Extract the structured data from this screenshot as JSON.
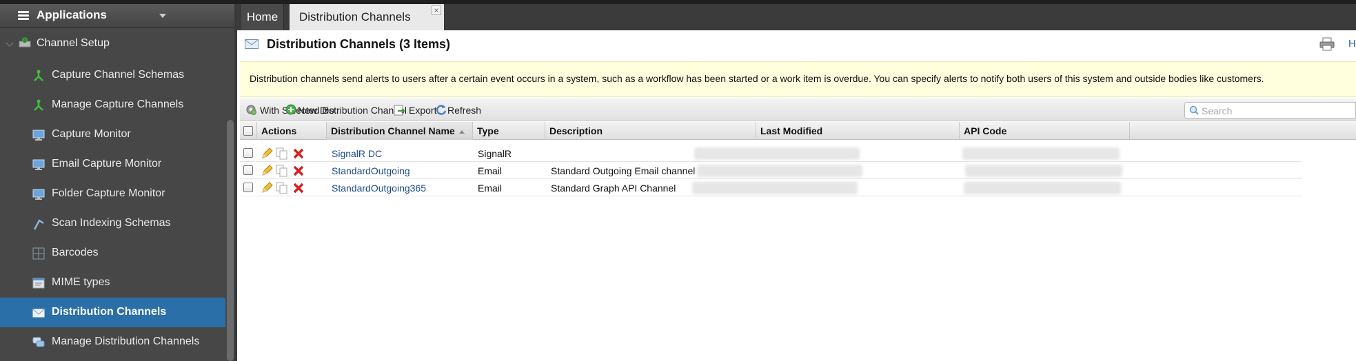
{
  "sidebar": {
    "header_title": "Applications",
    "root_label": "Channel Setup",
    "items": [
      {
        "label": "Capture Channel Schemas",
        "icon": "schema-icon"
      },
      {
        "label": "Manage Capture Channels",
        "icon": "schema-icon"
      },
      {
        "label": "Capture Monitor",
        "icon": "monitor-icon"
      },
      {
        "label": "Email Capture Monitor",
        "icon": "monitor-icon"
      },
      {
        "label": "Folder Capture Monitor",
        "icon": "monitor-icon"
      },
      {
        "label": "Scan Indexing Schemas",
        "icon": "scan-icon"
      },
      {
        "label": "Barcodes",
        "icon": "barcode-icon"
      },
      {
        "label": "MIME types",
        "icon": "mime-icon"
      },
      {
        "label": "Distribution Channels",
        "icon": "envelope-icon",
        "active": true
      },
      {
        "label": "Manage Distribution Channels",
        "icon": "chat-icon"
      }
    ]
  },
  "tabs": [
    {
      "label": "Home"
    },
    {
      "label": "Distribution Channels",
      "close": "×"
    }
  ],
  "page": {
    "title": "Distribution Channels (3 Items)",
    "help_label": "H",
    "info": "Distribution channels send alerts to users after a certain event occurs in a system, such as a workflow has been started or a work item is overdue. You can specify alerts to notify both users of this system and outside bodies like customers."
  },
  "toolbar": {
    "with_selected": "With Selected Do:",
    "new_channel": "New Distribution Channel",
    "export": "Export",
    "refresh": "Refresh",
    "search_placeholder": "Search"
  },
  "grid": {
    "columns": [
      "Actions",
      "Distribution Channel Name",
      "Type",
      "Description",
      "Last Modified",
      "API Code"
    ],
    "rows": [
      {
        "name": "SignalR DC",
        "type": "SignalR",
        "description": ""
      },
      {
        "name": "StandardOutgoing",
        "type": "Email",
        "description": "Standard Outgoing Email channel"
      },
      {
        "name": "StandardOutgoing365",
        "type": "Email",
        "description": "Standard Graph API Channel"
      }
    ]
  },
  "colors": {
    "sidebar_bg": "#474747",
    "active_item": "#2a6fa8",
    "info_bg": "#ffffdd",
    "link": "#1a4a8a",
    "delete_red": "#d42020"
  }
}
